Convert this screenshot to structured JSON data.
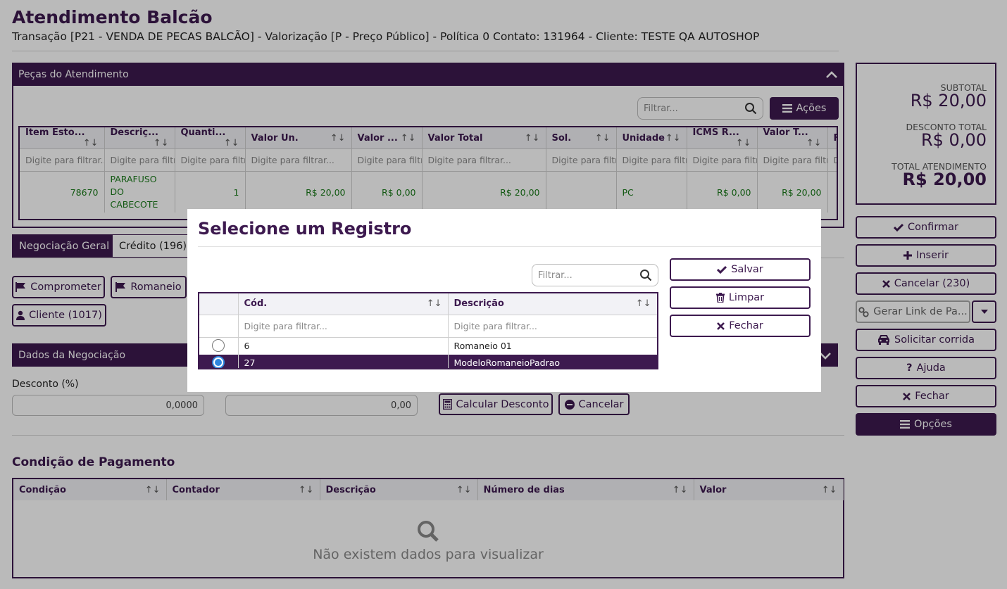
{
  "page": {
    "title": "Atendimento Balcão",
    "subtitle": "Transação [P21 - VENDA DE PECAS BALCÃO] - Valorização [P - Preço Público] - Política 0 Contato: 131964 - Cliente: TESTE QA AUTOSHOP"
  },
  "pecas_panel": {
    "title": "Peças do Atendimento",
    "filter_placeholder": "Filtrar...",
    "actions_label": "Ações",
    "columns": [
      "Item Esto...",
      "Descriç...",
      "Quanti...",
      "Valor Un.",
      "Valor ...",
      "Valor Total",
      "Sol.",
      "Unidade",
      "ICMS R...",
      "Valor T...",
      "F"
    ],
    "filter_placeholders": [
      "Digite para filtrar...",
      "Digite para filtr",
      "Digite para filtr",
      "Digite para filtrar...",
      "Digite para filtr",
      "Digite para filtrar...",
      "Digite para filtr",
      "Digite para filtr",
      "Digite para filtr",
      "Digite para filtr",
      "D"
    ],
    "rows": [
      {
        "item": "78670",
        "descricao": "PARAFUSO DO CABECOTE",
        "quantidade": "1",
        "valor_un": "R$ 20,00",
        "valor_desc": "R$ 0,00",
        "valor_total": "R$ 20,00",
        "sol": "",
        "unidade": "PC",
        "icms": "R$ 0,00",
        "valor_t": "R$ 20,00"
      }
    ]
  },
  "tabs": [
    "Negociação Geral",
    "Crédito (196)"
  ],
  "action_buttons": {
    "comprometer": "Comprometer",
    "romaneio": "Romaneio",
    "cliente": "Cliente (1017)"
  },
  "negociacao": {
    "title": "Dados da Negociação",
    "desconto_label": "Desconto (%)",
    "desconto_value": "0,0000",
    "valor_value": "0,00",
    "calc_label": "Calcular Desconto",
    "cancel_label": "Cancelar"
  },
  "pagamento": {
    "title": "Condição de Pagamento",
    "columns": [
      "Condição",
      "Contador",
      "Descrição",
      "Número de dias",
      "Valor"
    ],
    "empty_text": "Não existem dados para visualizar"
  },
  "totals": {
    "subtotal_label": "SUBTOTAL",
    "subtotal_value": "R$ 20,00",
    "desconto_label": "DESCONTO TOTAL",
    "desconto_value": "R$ 0,00",
    "total_label": "TOTAL ATENDIMENTO",
    "total_value": "R$ 20,00"
  },
  "side_buttons": {
    "confirmar": "Confirmar",
    "inserir": "Inserir",
    "cancelar": "Cancelar (230)",
    "gerar_link": "Gerar Link de Pa...",
    "solicitar": "Solicitar corrida",
    "ajuda": "Ajuda",
    "fechar": "Fechar",
    "opcoes": "Opções"
  },
  "modal": {
    "title": "Selecione um Registro",
    "filter_placeholder": "Filtrar...",
    "columns": [
      "Cód.",
      "Descrição"
    ],
    "filter_placeholders": [
      "Digite para filtrar...",
      "Digite para filtrar..."
    ],
    "rows": [
      {
        "cod": "6",
        "descricao": "Romaneio 01",
        "selected": false
      },
      {
        "cod": "27",
        "descricao": "ModeloRomaneioPadrao",
        "selected": true
      }
    ],
    "salvar": "Salvar",
    "limpar": "Limpar",
    "fechar": "Fechar"
  },
  "colors": {
    "brand": "#3d1a4f",
    "value_green": "#1a7a1a",
    "radio_blue": "#2e86de"
  }
}
